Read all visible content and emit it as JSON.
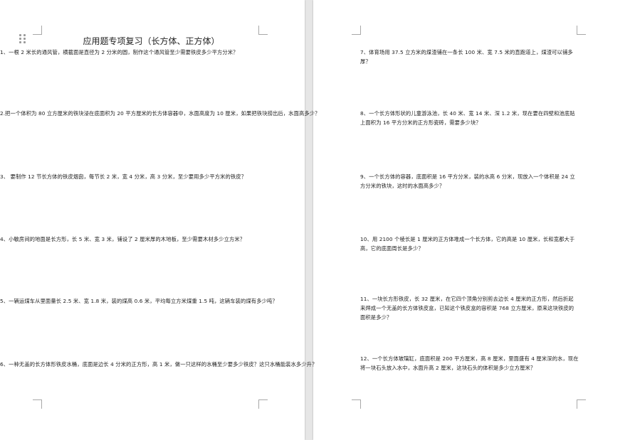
{
  "document": {
    "title": "应用题专项复习（长方体、正方体）",
    "left_questions": [
      "1、一根 2 米长的通风管，横截面是直径为 2 分米的圆，制作这个通风管至少需要铁皮多少平方分米？",
      "2.把一个体积为 80 立方厘米的铁块浸在底面积为 20 平方厘米的长方体容器中，水面高度为 10 厘米，如果把铁块捞出后，水面高多少？",
      "3、 要制作 12 节长方体的铁皮烟囱，每节长 2 米，宽 4 分米，高 3 分米，至少要用多少平方米的铁皮？",
      "4、小敏房间的地面是长方形，长 5 米、宽 3 米，铺设了 2 厘米厚的木地板，至少需要木材多少立方米？",
      "5、一辆运煤车从里面量长 2.5 米、宽 1.8 米，装的煤高 0.6 米，平均每立方米煤重 1.5 吨，这辆车装的煤有多少吨？",
      "6、一种无盖的长方体形铁皮水桶，底面是边长 4 分米的正方形，高 1 米，做一只这样的水桶至少要多少铁皮？这只水桶能装水多少升？"
    ],
    "right_questions": [
      "7、体育场用 37.5 立方米的煤渣铺在一条长 100 米、宽 7.5 米的直跑道上，煤渣可以铺多厚？",
      "8、一个长方体形状的儿童游泳池，长 40 米、宽 14 米、深 1.2 米，现在要在四壁和池底贴上面积为 16 平方分米的正方形瓷砖，需要多少块？",
      "9、一个长方体的容器，底面积是 16 平方分米，装的水高 6 分米，现放入一个体积是 24 立方分米的铁块，这时的水面高多少？",
      "10、用 2100 个棱长是 1 厘米的正方体堆成一个长方体，它的高是 10 厘米，长和宽都大于高，它的底面周长是多少？",
      "11、一块长方形铁皮，长 32 厘米，在它四个顶角分别剪去边长 4 厘米的正方形，然后折起来焊成一个无盖的长方体铁皮盒，已知这个铁皮盒的容积是 768 立方厘米，原来这块铁皮的面积是多少？",
      "12、一个长方体玻璃缸，底面积是 200 平方厘米，高 8 厘米，里面盛有 4 厘米深的水，现在将一块石头放入水中，水面升高 2 厘米，这块石头的体积是多少立方厘米？"
    ]
  }
}
